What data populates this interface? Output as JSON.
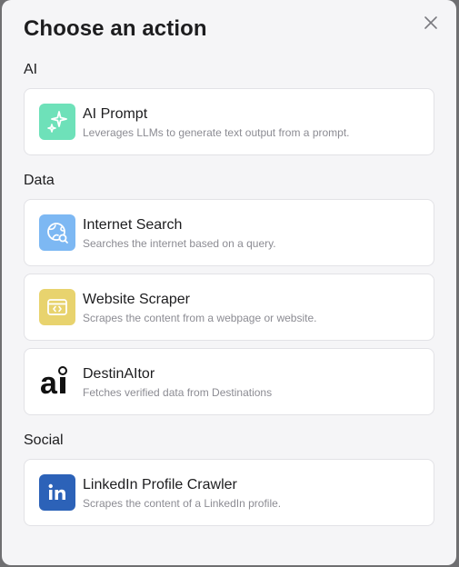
{
  "dialog": {
    "title": "Choose an action",
    "close_icon": "close-icon"
  },
  "sections": [
    {
      "label": "AI",
      "items": [
        {
          "title": "AI Prompt",
          "description": "Leverages LLMs to generate text output from a prompt.",
          "icon": "sparkles-icon",
          "icon_bg": "#6ee1b9"
        }
      ]
    },
    {
      "label": "Data",
      "items": [
        {
          "title": "Internet Search",
          "description": "Searches the internet based on a query.",
          "icon": "globe-search-icon",
          "icon_bg": "#7db8f3"
        },
        {
          "title": "Website Scraper",
          "description": "Scrapes the content from a webpage or website.",
          "icon": "browser-code-icon",
          "icon_bg": "#e8d36e"
        },
        {
          "title": "DestinAItor",
          "description": "Fetches verified data from Destinations",
          "icon": "ai-logo-icon",
          "icon_bg": "#ffffff"
        }
      ]
    },
    {
      "label": "Social",
      "items": [
        {
          "title": "LinkedIn Profile Crawler",
          "description": "Scrapes the content of a LinkedIn profile.",
          "icon": "linkedin-icon",
          "icon_bg": "#2c62b8"
        }
      ]
    }
  ]
}
